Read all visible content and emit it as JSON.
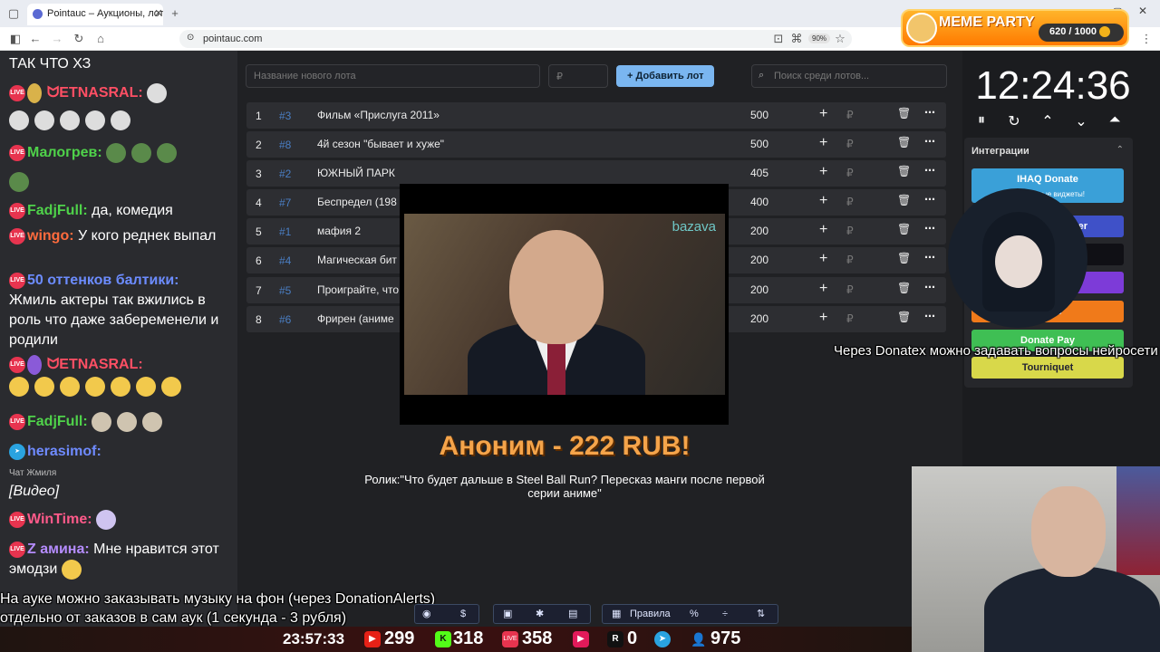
{
  "browser": {
    "tab_title": "Pointauc – Аукционы, лотере…",
    "new_tab": "+",
    "url": "pointauc.com",
    "zoom": "90%"
  },
  "meme_party": {
    "label": "MEME PARTY",
    "progress": "620 / 1000",
    "progress_fraction": 0.62
  },
  "chat": {
    "lines": [
      {
        "text": "ТАК ЧТО ХЗ"
      },
      {
        "user": "ᗢETNASRAL:",
        "color": "#ff4f64"
      },
      {
        "user": "Малогрев:",
        "color": "#4fd24a"
      },
      {
        "user": "FadjFull:",
        "color": "#4fd24a",
        "msg": " да, комедия"
      },
      {
        "user": "wingo:",
        "color": "#ff6b3d",
        "msg": " У кого реднек выпал"
      },
      {
        "user": "50 оттенков балтики:",
        "color": "#6c8cff"
      },
      {
        "text": "Жмиль актеры так вжились в роль что даже забеременели и родили",
        "bold_word": "Жмиль"
      },
      {
        "user": "ᗢETNASRAL:",
        "color": "#ff4f64"
      },
      {
        "user": "FadjFull:",
        "color": "#4fd24a"
      },
      {
        "user": "herasimof:",
        "color": "#6f8bff"
      },
      {
        "sub": "Чат Жмиля"
      },
      {
        "text": "[Видео]"
      },
      {
        "user": "WinTime:",
        "color": "#ff5a8a"
      },
      {
        "user": "Z амина:",
        "color": "#b58cff",
        "msg": " Мне нравится этот эмодзи"
      }
    ]
  },
  "auction": {
    "new_lot_placeholder": "Название нового лота",
    "amount_placeholder": "₽",
    "add_button": "+ Добавить лот",
    "search_placeholder": "Поиск среди лотов...",
    "currency": "₽",
    "plus": "+",
    "trash": "🗑",
    "more": "⋯",
    "lots": [
      {
        "n": "1",
        "id": "#3",
        "name": "Фильм «Прислуга 2011»",
        "amount": "500"
      },
      {
        "n": "2",
        "id": "#8",
        "name": "4й сезон \"бывает и хуже\"",
        "amount": "500"
      },
      {
        "n": "3",
        "id": "#2",
        "name": "ЮЖНЫЙ ПАРК",
        "amount": "405"
      },
      {
        "n": "4",
        "id": "#7",
        "name": "Беспредел (198",
        "amount": "400"
      },
      {
        "n": "5",
        "id": "#1",
        "name": "мафия 2",
        "amount": "200"
      },
      {
        "n": "6",
        "id": "#4",
        "name": "Магическая бит",
        "amount": "200"
      },
      {
        "n": "7",
        "id": "#5",
        "name": "Проиграйте, что",
        "amount": "200"
      },
      {
        "n": "8",
        "id": "#6",
        "name": "Фрирен (аниме",
        "amount": "200"
      }
    ]
  },
  "donation": {
    "video_watermark": "bazava",
    "title": "Аноним - 222 RUB!",
    "message": "Ролик:\"Что будет дальше в Steel Ball Run? Пересказ манги после первой серии аниме\""
  },
  "timer": {
    "time": "12:24:36",
    "pause": "⏸",
    "reset": "↻",
    "up": "⌃",
    "down": "⌄",
    "collapse": "⏶"
  },
  "integrations": {
    "title": "Интеграции",
    "collapse": "⌃",
    "items": [
      {
        "label": "IHAQ Donate",
        "sub": "Уникальные виджеты!",
        "color": "#3aa0d8"
      },
      {
        "label": "er",
        "color": "#3f51c8"
      },
      {
        "label": "",
        "color": "#101015"
      },
      {
        "label": "",
        "color": "#7d3bd8"
      },
      {
        "label": "Alerts",
        "color": "#f07a1a"
      },
      {
        "label": "Donate Pay",
        "color": "#3fbf54"
      },
      {
        "label": "Tourniquet",
        "color": "#d8d84a"
      }
    ]
  },
  "overlay": {
    "donatex_text": "Через Donatex можно задавать вопросы нейросети",
    "music_text_1": "На ауке можно заказывать музыку на фон (через DonationAlerts)",
    "music_text_2": "отдельно от заказов в сам аук (1 секунда - 3 рубля)"
  },
  "toolbar": {
    "rules": "Правила",
    "percent": "%",
    "dollar": "$"
  },
  "stream_stats": {
    "clock": "23:57:33",
    "youtube": "299",
    "kick": "318",
    "vk": "358",
    "rutube": "0",
    "telegram": "975"
  }
}
